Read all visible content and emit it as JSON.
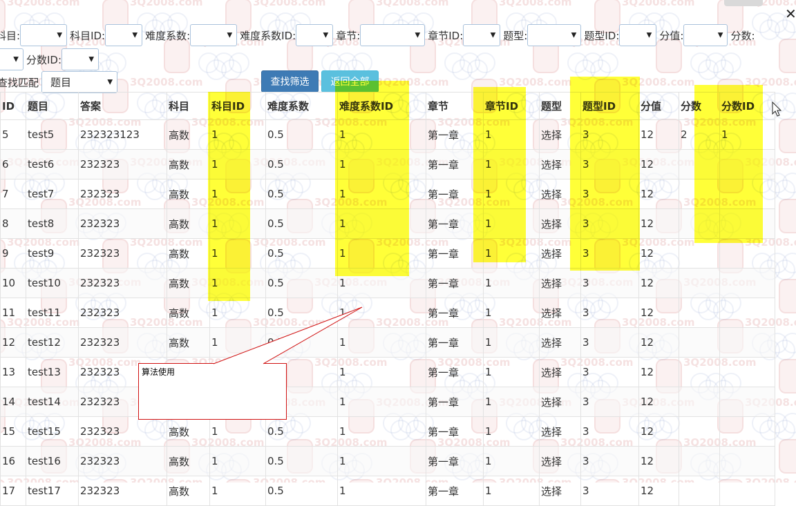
{
  "watermark": {
    "text": "3Q2008.com"
  },
  "filters": {
    "row1": [
      {
        "label": "科目:",
        "value": "",
        "width": 68
      },
      {
        "label": "科目ID:",
        "value": "",
        "width": 54
      },
      {
        "label": "难度系数:",
        "value": "",
        "width": 68
      },
      {
        "label": "难度系数ID:",
        "value": "",
        "width": 54
      },
      {
        "label": "章节:",
        "value": "",
        "width": 94
      },
      {
        "label": "章节ID:",
        "value": "",
        "width": 54
      },
      {
        "label": "题型:",
        "value": "",
        "width": 78
      },
      {
        "label": "题型ID:",
        "value": "",
        "width": 54
      },
      {
        "label": "分值:",
        "value": "",
        "width": 64
      },
      {
        "label": "分数:",
        "value": "",
        "width": 0
      }
    ],
    "row2": [
      {
        "label": "",
        "value": "",
        "width": 48
      },
      {
        "label": "分数ID:",
        "value": "",
        "width": 54
      }
    ],
    "match": {
      "label": "查找匹配",
      "value": "题目"
    }
  },
  "buttons": {
    "search": "查找筛选",
    "reset": "返回全部"
  },
  "table": {
    "columns": [
      "ID",
      "题目",
      "答案",
      "科目",
      "科目ID",
      "难度系数",
      "难度系数ID",
      "章节",
      "章节ID",
      "题型",
      "题型ID",
      "分值",
      "分数",
      "分数ID"
    ],
    "rows": [
      [
        "5",
        "test5",
        "232323123",
        "高数",
        "1",
        "0.5",
        "1",
        "第一章",
        "1",
        "选择",
        "3",
        "12",
        "2",
        "1"
      ],
      [
        "6",
        "test6",
        "232323",
        "高数",
        "1",
        "0.5",
        "1",
        "第一章",
        "1",
        "选择",
        "3",
        "12",
        "",
        ""
      ],
      [
        "7",
        "test7",
        "232323",
        "高数",
        "1",
        "0.5",
        "1",
        "第一章",
        "1",
        "选择",
        "3",
        "12",
        "",
        ""
      ],
      [
        "8",
        "test8",
        "232323",
        "高数",
        "1",
        "0.5",
        "1",
        "第一章",
        "1",
        "选择",
        "3",
        "12",
        "",
        ""
      ],
      [
        "9",
        "test9",
        "232323",
        "高数",
        "1",
        "0.5",
        "1",
        "第一章",
        "1",
        "选择",
        "3",
        "12",
        "",
        ""
      ],
      [
        "10",
        "test10",
        "232323",
        "高数",
        "1",
        "0.5",
        "1",
        "第一章",
        "1",
        "选择",
        "3",
        "12",
        "",
        ""
      ],
      [
        "11",
        "test11",
        "232323",
        "高数",
        "1",
        "0.5",
        "1",
        "第一章",
        "1",
        "选择",
        "3",
        "12",
        "",
        ""
      ],
      [
        "12",
        "test12",
        "232323",
        "高数",
        "1",
        "0.5",
        "1",
        "第一章",
        "1",
        "选择",
        "3",
        "12",
        "",
        ""
      ],
      [
        "13",
        "test13",
        "232323",
        "高数",
        "",
        "",
        "1",
        "第一章",
        "1",
        "选择",
        "3",
        "12",
        "",
        ""
      ],
      [
        "14",
        "test14",
        "232323",
        "",
        "",
        "",
        "1",
        "第一章",
        "1",
        "选择",
        "3",
        "12",
        "",
        ""
      ],
      [
        "15",
        "test15",
        "232323",
        "高数",
        "1",
        "0.5",
        "1",
        "第一章",
        "1",
        "选择",
        "3",
        "12",
        "",
        ""
      ],
      [
        "16",
        "test16",
        "232323",
        "高数",
        "1",
        "0.5",
        "1",
        "第一章",
        "1",
        "选择",
        "3",
        "12",
        "",
        ""
      ],
      [
        "17",
        "test17",
        "232323",
        "高数",
        "1",
        "0.5",
        "1",
        "第一章",
        "1",
        "选择",
        "3",
        "12",
        "",
        ""
      ]
    ]
  },
  "annotation": {
    "text": "算法使用"
  },
  "colors": {
    "highlight": "#ffff00",
    "callout_border": "#d01010",
    "primary": "#3e7bb5",
    "info": "#5bc0de"
  }
}
